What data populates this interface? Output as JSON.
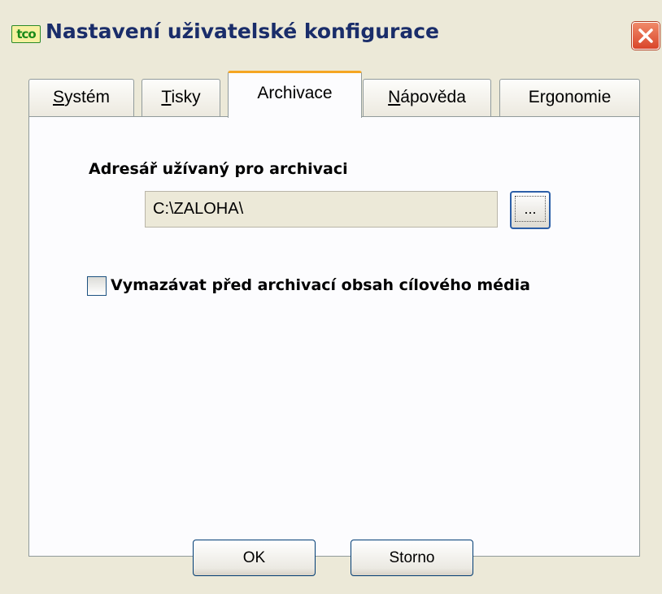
{
  "window": {
    "icon_text": "tco",
    "title": "Nastavení uživatelské konfigurace"
  },
  "tabs": [
    {
      "label": "Systém",
      "mnemonic": "S",
      "active": false
    },
    {
      "label": "Tisky",
      "mnemonic": "T",
      "active": false
    },
    {
      "label": "Archivace",
      "mnemonic": "",
      "active": true
    },
    {
      "label": "Nápověda",
      "mnemonic": "N",
      "active": false
    },
    {
      "label": "Ergonomie",
      "mnemonic": "",
      "active": false
    }
  ],
  "archive": {
    "dir_label": "Adresář užívaný pro archivaci",
    "dir_value": "C:\\ZALOHA\\",
    "browse_label": "...",
    "erase_label": "Vymazávat před archivací obsah cílového média",
    "erase_checked": false
  },
  "buttons": {
    "ok": "OK",
    "cancel": "Storno"
  },
  "colors": {
    "title_text": "#1a2d6a",
    "active_tab_accent": "#f5a623",
    "button_border": "#003c74"
  }
}
